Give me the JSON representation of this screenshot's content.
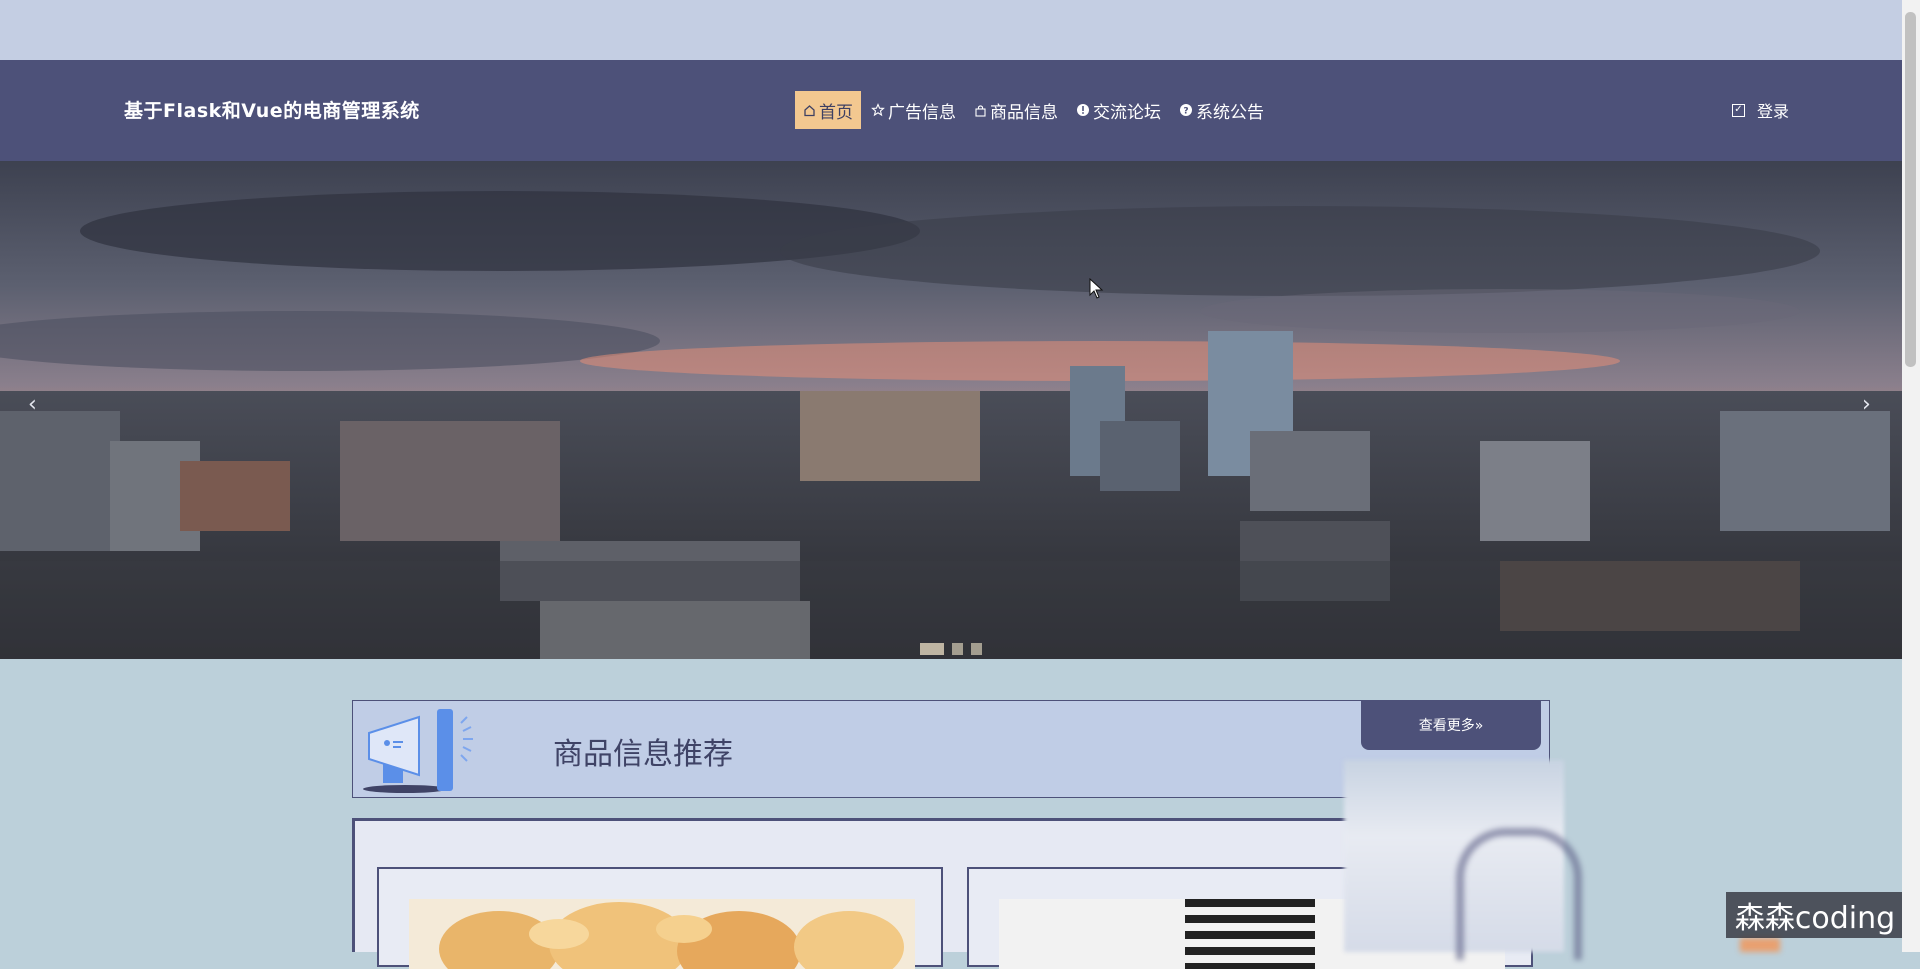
{
  "app": {
    "title": "基于Flask和Vue的电商管理系统"
  },
  "nav": {
    "items": [
      {
        "label": "首页",
        "icon": "home-icon",
        "active": true
      },
      {
        "label": "广告信息",
        "icon": "star-icon",
        "active": false
      },
      {
        "label": "商品信息",
        "icon": "bag-icon",
        "active": false
      },
      {
        "label": "交流论坛",
        "icon": "info-icon",
        "active": false
      },
      {
        "label": "系统公告",
        "icon": "help-icon",
        "active": false
      }
    ],
    "login_label": "登录",
    "login_icon": "checkbox-icon"
  },
  "carousel": {
    "prev_icon": "chevron-left-icon",
    "next_icon": "chevron-right-icon",
    "slide_count": 3,
    "active_slide": 1
  },
  "recommend": {
    "title": "商品信息推荐",
    "more_label": "查看更多»",
    "icon": "megaphone-icon"
  },
  "watermark": {
    "text": "森森coding"
  },
  "colors": {
    "nav_bg": "#4d5179",
    "active_nav_bg": "#f3c890",
    "page_bg": "#bcd0da",
    "top_strip": "#c4cee3",
    "header_panel_bg": "#c0cde6"
  }
}
